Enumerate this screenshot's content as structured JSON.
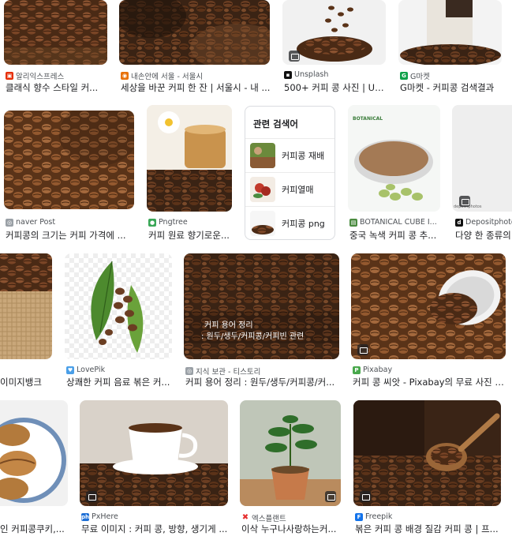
{
  "results": [
    {
      "source": "알리익스프레스",
      "title": "클래식 향수 스타일 커...",
      "favicon_color": "#e62e04",
      "favicon_glyph": "▣"
    },
    {
      "source": "내손안에 서울 - 서울시",
      "title": "세상을 바꾼 커피 한 잔 | 서울시 - 내 ...",
      "favicon_color": "#e8710a",
      "favicon_glyph": "◉"
    },
    {
      "source": "Unsplash",
      "title": "500+ 커피 콩 사진 | Uns...",
      "favicon_color": "#111111",
      "favicon_glyph": "▪"
    },
    {
      "source": "G마켓",
      "title": "G마켓 - 커피콩 검색결과",
      "favicon_color": "#0fa14a",
      "favicon_glyph": "G"
    },
    {
      "source": "naver Post",
      "title": "커피콩의 크기는 커피 가격에 ...",
      "favicon_color": "#9aa0a6",
      "favicon_glyph": "◎"
    },
    {
      "source": "Pngtree",
      "title": "커피 원료 향기로운...",
      "favicon_color": "#3aa757",
      "favicon_glyph": "●"
    },
    {
      "source": "BOTANICAL CUBE I...",
      "title": "중국 녹색 커피 콩 추...",
      "favicon_color": "#4a8b3f",
      "favicon_glyph": "▤"
    },
    {
      "source": "Depositphotos",
      "title": "다양 한 종류의",
      "favicon_color": "#111111",
      "favicon_glyph": "d"
    },
    {
      "source": "",
      "title": "이미지뱅크",
      "favicon_color": "#ffffff",
      "favicon_glyph": ""
    },
    {
      "source": "LovePik",
      "title": "상쾌한 커피 음료 볶은 커...",
      "favicon_color": "#4a9fe8",
      "favicon_glyph": "♥"
    },
    {
      "source": "지식 보관 - 티스토리",
      "title": "커피 용어 정리 : 원두/생두/커피콩/커...",
      "favicon_color": "#9aa0a6",
      "favicon_glyph": "◎"
    },
    {
      "source": "Pixabay",
      "title": "커피 콩 씨앗 - Pixabay의 무료 사진 - ...",
      "favicon_color": "#49a84c",
      "favicon_glyph": "P"
    },
    {
      "source": "",
      "title": "인 커피콩쿠키,...",
      "favicon_color": "#ffffff",
      "favicon_glyph": ""
    },
    {
      "source": "PxHere",
      "title": "무료 이미지 : 커피 콩, 방향, 생기게 ...",
      "favicon_color": "#1e6fd6",
      "favicon_glyph": "ph"
    },
    {
      "source": "엑스플랜트",
      "title": "이삭 누구나사랑하는커...",
      "favicon_color": "#e62e2e",
      "favicon_glyph": "✖"
    },
    {
      "source": "Freepik",
      "title": "볶은 커피 콩 배경 질감 커피 콩 | 프...",
      "favicon_color": "#1273eb",
      "favicon_glyph": "F"
    }
  ],
  "related": {
    "heading": "관련 검색어",
    "items": [
      "커피콩 재배",
      "커피열매",
      "커피콩 png"
    ]
  },
  "overlays": {
    "botanical_logo": "BOTANICAL",
    "blog_caption_line1": "커피 용어 정리",
    "blog_caption_line2": ": 원두/생두/커피콩/커피빈 관련",
    "deposit_mark": "depositphotos"
  }
}
